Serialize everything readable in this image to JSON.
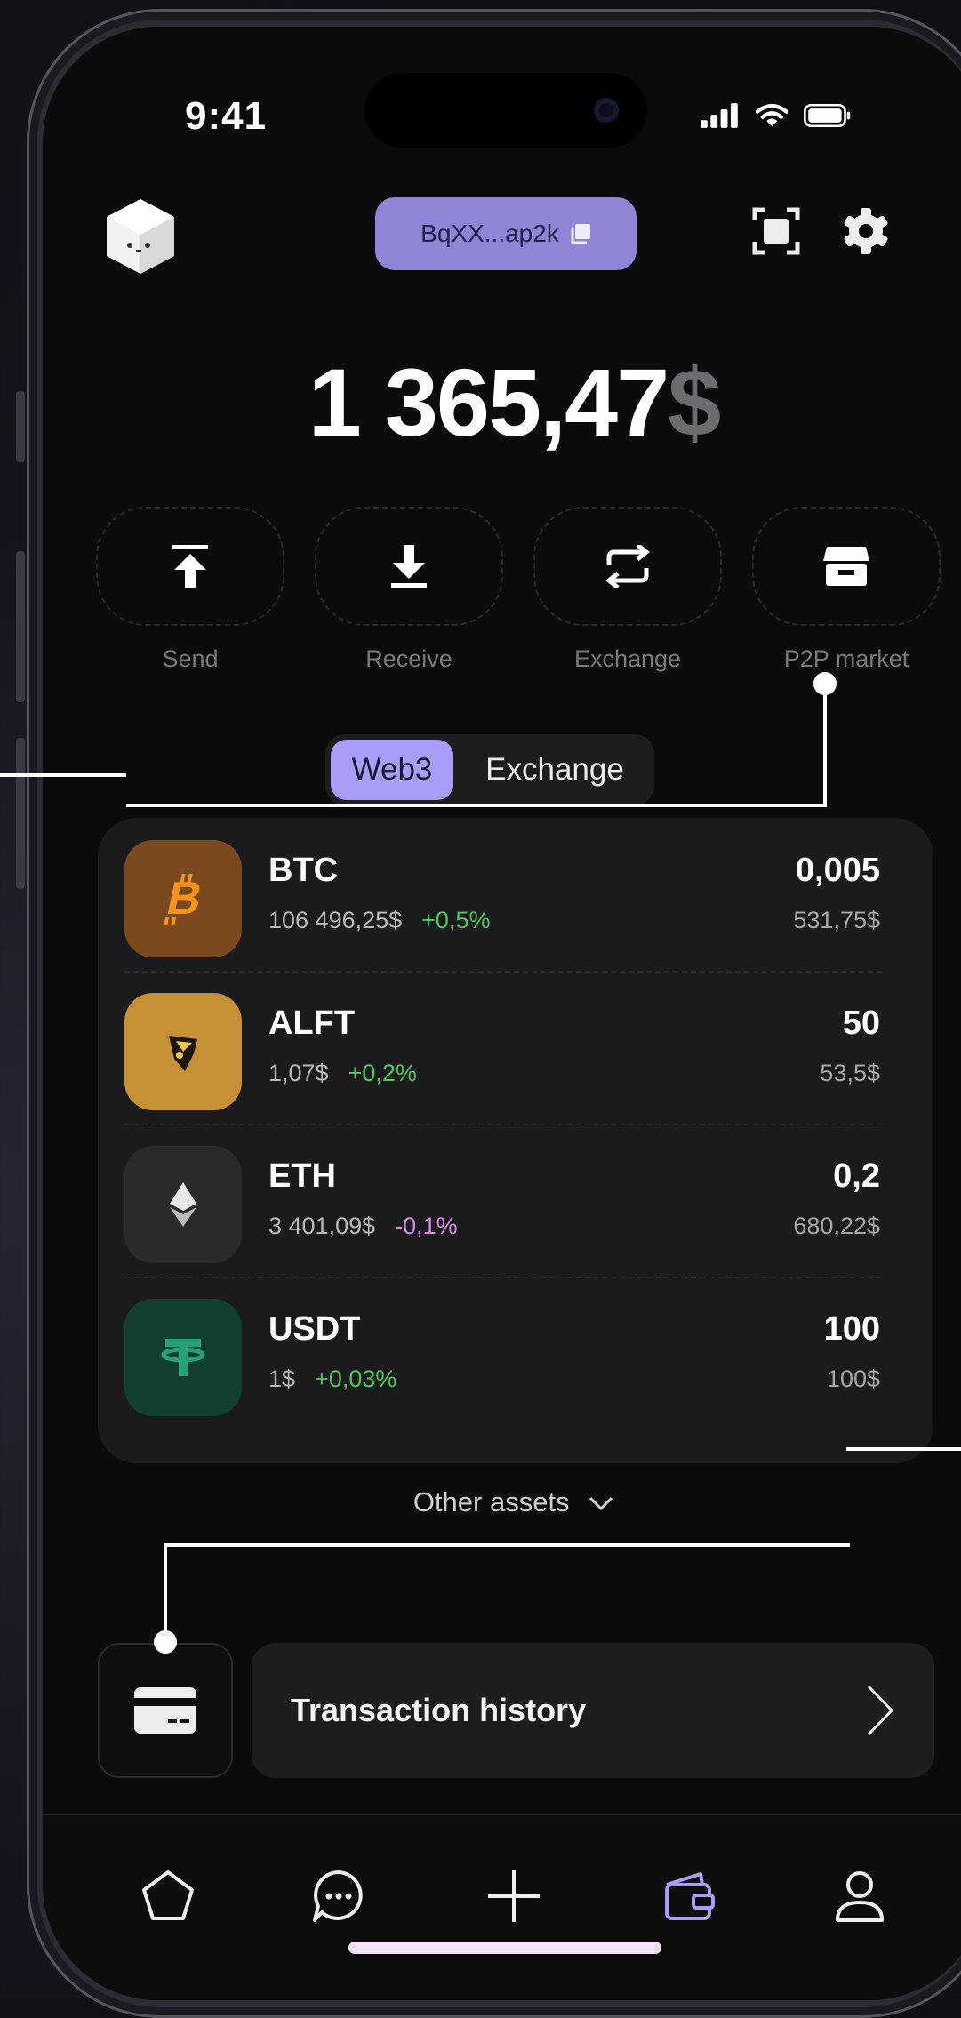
{
  "status_bar": {
    "time": "9:41"
  },
  "header": {
    "wallet_address": "BqXX...ap2k"
  },
  "balance": {
    "amount": "1 365,47",
    "currency": "$"
  },
  "actions": [
    {
      "label": "Send",
      "icon": "send-icon"
    },
    {
      "label": "Receive",
      "icon": "receive-icon"
    },
    {
      "label": "Exchange",
      "icon": "exchange-icon"
    },
    {
      "label": "P2P market",
      "icon": "store-icon"
    }
  ],
  "segment": {
    "options": [
      "Web3",
      "Exchange"
    ],
    "selected": "Web3"
  },
  "assets": [
    {
      "symbol": "BTC",
      "price": "106 496,25$",
      "change": "+0,5%",
      "amount": "0,005",
      "usd": "531,75$",
      "icon": "bitcoin-icon"
    },
    {
      "symbol": "ALFT",
      "price": "1,07$",
      "change": "+0,2%",
      "amount": "50",
      "usd": "53,5$",
      "icon": "alft-icon"
    },
    {
      "symbol": "ETH",
      "price": "3 401,09$",
      "change": "-0,1%",
      "amount": "0,2",
      "usd": "680,22$",
      "icon": "ethereum-icon"
    },
    {
      "symbol": "USDT",
      "price": "1$",
      "change": "+0,03%",
      "amount": "100",
      "usd": "100$",
      "icon": "tether-icon"
    }
  ],
  "other_assets": {
    "label": "Other assets"
  },
  "transaction_history": {
    "label": "Transaction history"
  },
  "tabbar": {
    "items": [
      "home-icon",
      "chat-icon",
      "plus-icon",
      "wallet-icon",
      "profile-icon"
    ],
    "active": "wallet-icon"
  },
  "colors": {
    "accent": "#a89ef7",
    "address_pill": "#8e85d6",
    "positive": "#4cc95a",
    "negative": "#d88ee6",
    "btc": "#7a4a1e",
    "alft": "#c69034",
    "eth": "#2a2a2d",
    "usdt": "#12402f"
  }
}
